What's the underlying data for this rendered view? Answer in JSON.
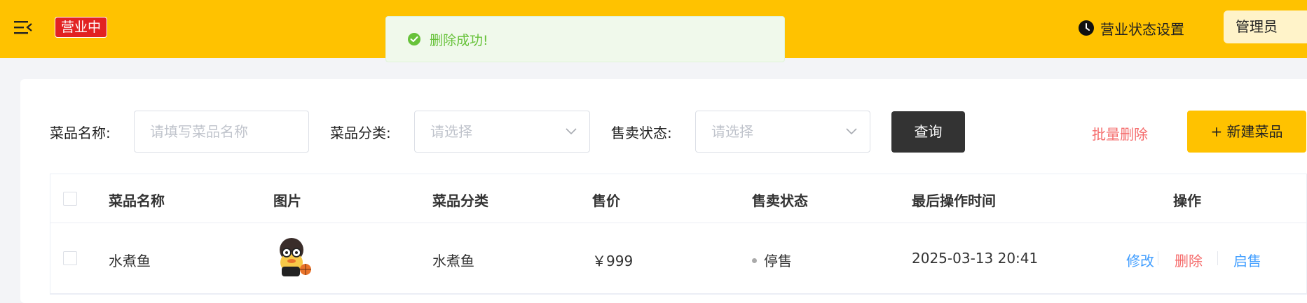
{
  "header": {
    "status_badge": "营业中",
    "settings_label": "营业状态设置",
    "admin_label": "管理员",
    "bg_color": "#ffc200"
  },
  "toast": {
    "message": "删除成功!",
    "type": "success"
  },
  "filters": {
    "name_label": "菜品名称:",
    "name_placeholder": "请填写菜品名称",
    "category_label": "菜品分类:",
    "category_placeholder": "请选择",
    "status_label": "售卖状态:",
    "status_placeholder": "请选择",
    "query_button": "查询",
    "batch_delete": "批量删除",
    "new_button": "+ 新建菜品"
  },
  "table": {
    "columns": [
      "菜品名称",
      "图片",
      "菜品分类",
      "售价",
      "售卖状态",
      "最后操作时间",
      "操作"
    ],
    "rows": [
      {
        "name": "水煮鱼",
        "image": "dish-thumbnail",
        "category": "水煮鱼",
        "price": "￥999",
        "status": "停售",
        "updated": "2025-03-13 20:41",
        "actions": [
          "修改",
          "删除",
          "启售"
        ]
      }
    ]
  },
  "colors": {
    "accent": "#ffc200",
    "danger": "#f56c6c",
    "link": "#419eff",
    "success": "#67c23a"
  },
  "icons": [
    "menu-fold-icon",
    "clock-icon",
    "success-check-icon",
    "chevron-down-icon"
  ]
}
